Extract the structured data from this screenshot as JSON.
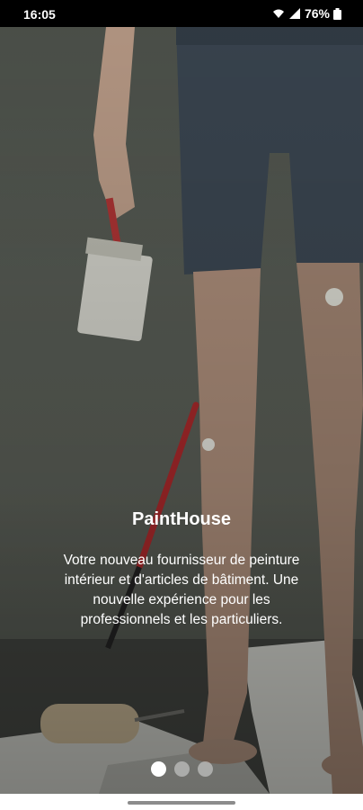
{
  "status_bar": {
    "time": "16:05",
    "battery": "76%",
    "icons": [
      "wifi-icon",
      "signal-icon",
      "battery-icon"
    ]
  },
  "onboarding": {
    "title": "PaintHouse",
    "description": "Votre nouveau fournisseur de peinture intérieur et d'articles de bâtiment. Une nouvelle expérience pour les professionnels et les particuliers.",
    "page_count": 3,
    "active_page": 1
  },
  "colors": {
    "text": "#ffffff",
    "dot_active": "#ffffff",
    "dot_inactive": "#c8c8c8",
    "status_bar": "#000000"
  }
}
